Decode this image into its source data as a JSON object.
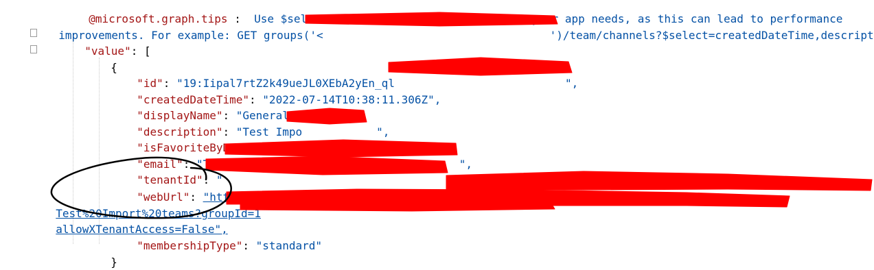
{
  "tips": {
    "key": "@microsoft.graph.tips",
    "sep": " : ",
    "text": " Use $select to choose only the properties your app needs, as this can lead to performance",
    "cont_a": "improvements. For example: GET groups('<",
    "cont_b": "')/team/channels?$select=createdDateTime,descript"
  },
  "value_key": "\"value\"",
  "open_bracket": "[",
  "open_brace": "{",
  "close_brace": "}",
  "fields": {
    "id": {
      "key": "\"id\"",
      "value": "\"19:Iipal7rtZ2k49ueJL0XEbA2yEn_ql",
      "tail": "\","
    },
    "createdDateTime": {
      "key": "\"createdDateTime\"",
      "value": "\"2022-07-14T10:38:11.306Z\",",
      "tail": ""
    },
    "displayName": {
      "key": "\"displayName\"",
      "value": "\"General\",",
      "tail": ""
    },
    "description": {
      "key": "\"description\"",
      "value": "\"Test Impo",
      "tail": "\","
    },
    "isFavoriteByDefault": {
      "key": "\"isFavoriteByDefault\"",
      "value": "null,",
      "tail": ""
    },
    "email": {
      "key": "\"email\"",
      "value": "\"TestI",
      "tail": "\","
    },
    "tenantId": {
      "key": "\"tenantId\"",
      "value": "\"",
      "tail": "\","
    },
    "webUrl": {
      "key": "\"webUrl\"",
      "value": "\"https://teams.microsoft.com/l/channel/19%3AIipal7rtZ2k49",
      "line2": "Test%20Import%20teams?groupId=1",
      "line3": "allowXTenantAccess=False\","
    },
    "membershipType": {
      "key": "\"membershipType\"",
      "value": "\"standard\"",
      "tail": ""
    }
  },
  "colors": {
    "key": "#a31515",
    "string": "#0451a5",
    "null": "#0000ff",
    "redaction": "#ff0000",
    "annotation": "#000000"
  }
}
